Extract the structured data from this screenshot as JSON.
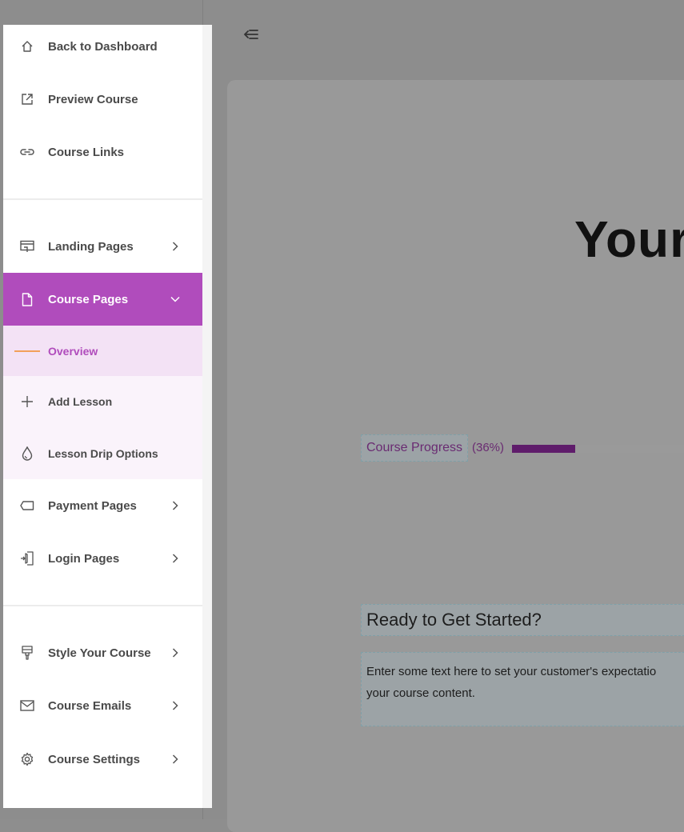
{
  "editor": {
    "hero_title": "Your",
    "progress_label": "Course Progress",
    "progress_percent_text": "(36%)",
    "progress_value": 0.36,
    "ready_title": "Ready to Get Started?",
    "description_line1": "Enter some text here to set your customer's expectatio",
    "description_line2": "your course content."
  },
  "sidebar": {
    "top_items": [
      {
        "label": "Back to Dashboard",
        "icon": "home-icon"
      },
      {
        "label": "Preview Course",
        "icon": "external-link-icon"
      },
      {
        "label": "Course Links",
        "icon": "link-icon"
      }
    ],
    "pages": [
      {
        "label": "Landing Pages",
        "icon": "landing-page-icon"
      },
      {
        "label": "Course Pages",
        "icon": "file-icon",
        "active": true
      },
      {
        "label": "Payment Pages",
        "icon": "tag-icon"
      },
      {
        "label": "Login Pages",
        "icon": "login-icon"
      }
    ],
    "course_pages_sub": [
      {
        "label": "Overview",
        "current": true
      },
      {
        "label": "Add Lesson",
        "icon": "plus-icon"
      },
      {
        "label": "Lesson Drip Options",
        "icon": "drop-icon"
      }
    ],
    "settings": [
      {
        "label": "Style Your Course",
        "icon": "brush-icon"
      },
      {
        "label": "Course Emails",
        "icon": "mail-icon"
      },
      {
        "label": "Course Settings",
        "icon": "gear-icon"
      }
    ]
  },
  "colors": {
    "accent": "#b04cbc",
    "accent_dark": "#5f1c6b",
    "sub_bg": "#faf3fb",
    "current_sub_bg": "#f3e2f5",
    "overview_line": "#f2a05a"
  }
}
